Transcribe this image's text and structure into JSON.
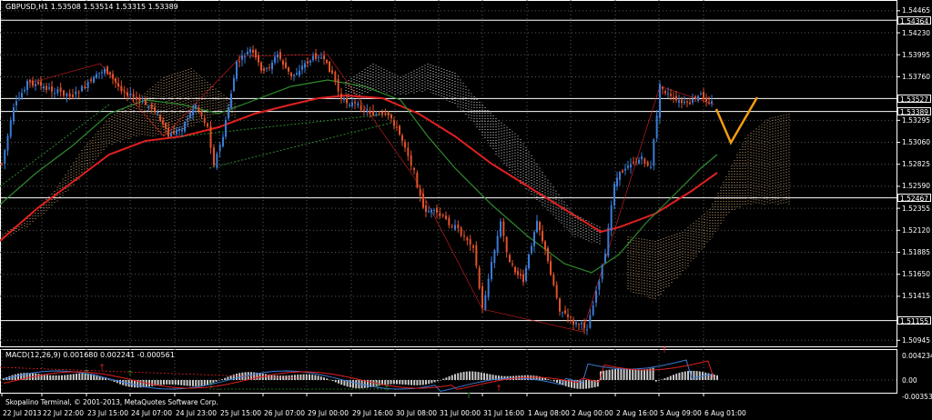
{
  "symbol_header": "GBPUSD,H1  1.53508 1.53514 1.53315 1.53389",
  "macd_header": "MACD(12,26,9) 0.001680 0.002241 -0.000561",
  "copyright": "Skopalino Terminal, © 2001-2013, MetaQuotes Software Corp.",
  "price_axis": [
    "1.54465",
    "1.54230",
    "1.53995",
    "1.53760",
    "1.53295",
    "1.53060",
    "1.52825",
    "1.52590",
    "1.52355",
    "1.52120",
    "1.51885",
    "1.51650",
    "1.51415",
    "1.50945"
  ],
  "highlighted_levels": [
    "1.54364",
    "1.53527",
    "1.53389",
    "1.52467",
    "1.51155"
  ],
  "macd_axis": [
    "0.004234",
    "0.00",
    "-0.003537"
  ],
  "time_axis": [
    "22 Jul 2013",
    "22 Jul 22:00",
    "23 Jul 15:00",
    "24 Jul 07:00",
    "24 Jul 23:00",
    "25 Jul 15:00",
    "26 Jul 07:00",
    "29 Jul 00:00",
    "29 Jul 16:00",
    "30 Jul 08:00",
    "31 Jul 00:00",
    "31 Jul 16:00",
    "1 Aug 08:00",
    "2 Aug 00:00",
    "2 Aug 16:00",
    "5 Aug 09:00",
    "6 Aug 01:00"
  ],
  "colors": {
    "background": "#000000",
    "grid": "#5a5a5a",
    "bull_candle": "#3a7bd5",
    "bear_candle": "#e0522a",
    "ma_slow": "#e02020",
    "ma_fast": "#2e8b2e",
    "cloud_orange": "#c8a070",
    "cloud_white": "#d8d8d8",
    "forecast": "#f39c12",
    "macd_histogram": "#c8c8c8",
    "macd_main": "#3a7bd5",
    "macd_signal": "#e02020"
  }
}
